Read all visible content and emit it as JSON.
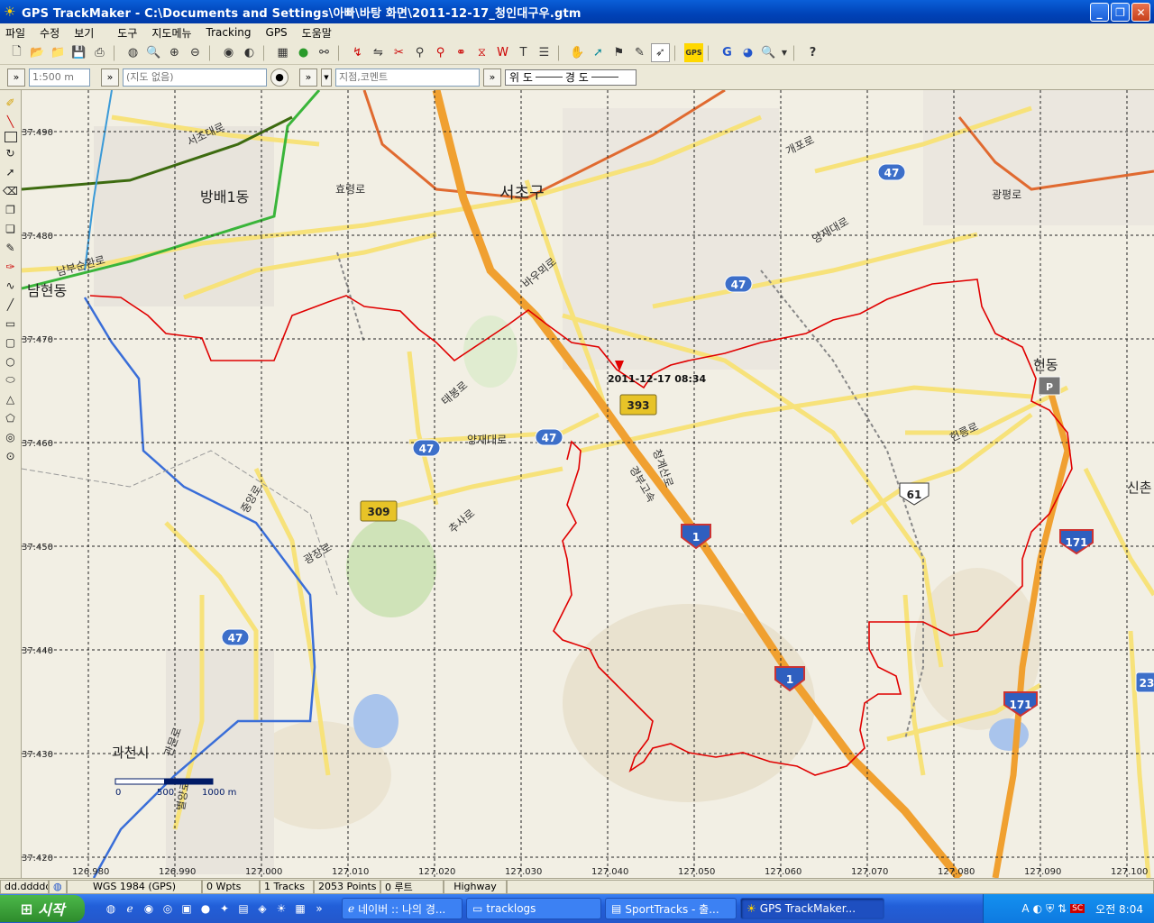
{
  "window": {
    "title": "GPS TrackMaker - C:\\Documents and Settings\\아빠\\바탕 화면\\2011-12-17_청인대구우.gtm"
  },
  "menu": [
    "파일",
    "수정",
    "보기",
    "도구",
    "지도메뉴",
    "Tracking",
    "GPS",
    "도움말"
  ],
  "toolbar2": {
    "scale_placeholder": "1:500 m",
    "map_placeholder": "(지도 없음)",
    "comment_placeholder": "지점,코멘트",
    "lat_label": "위 도",
    "lon_label": "경 도"
  },
  "map": {
    "lat_ticks": [
      "37.490",
      "37.480",
      "37.470",
      "37.460",
      "37.450",
      "37.440",
      "37.430",
      "37.420"
    ],
    "lon_ticks": [
      "126.980",
      "126.990",
      "127.000",
      "127.010",
      "127.020",
      "127.030",
      "127.040",
      "127.050",
      "127.060",
      "127.070",
      "127.080",
      "127.090",
      "127.100"
    ],
    "places": [
      "서초구",
      "방배1동",
      "남현동",
      "과천시",
      "헌동",
      "신촌"
    ],
    "roads": [
      "서초대로",
      "효령로",
      "남부순환로",
      "양재대로",
      "바우뫼로",
      "태봉로",
      "양재대로",
      "추사로",
      "광장로",
      "중앙로",
      "경부고속",
      "청계산로",
      "헌릉로",
      "개포로",
      "광평로",
      "관문로",
      "별양로"
    ],
    "shields": [
      "47",
      "47",
      "47",
      "47",
      "47",
      "393",
      "309",
      "1",
      "1",
      "61",
      "171",
      "171",
      "23"
    ],
    "track_label": "2011-12-17 08:34",
    "scale_labels": [
      "0",
      "500",
      "1000 m"
    ]
  },
  "statusbar": {
    "coord": "dd.ddddd",
    "datum": "WGS 1984 (GPS)",
    "wpts": "0 Wpts",
    "tracks": "1 Tracks",
    "points": "2053 Points",
    "routes": "0 루트",
    "layer": "Highway"
  },
  "taskbar": {
    "start": "시작",
    "tasks": [
      "네이버 :: 나의 경...",
      "tracklogs",
      "SportTracks - 출...",
      "GPS TrackMaker..."
    ],
    "clock": "오전 8:04"
  },
  "colors": {
    "track": "#e00000",
    "highway": "#f0a030",
    "road": "#f7e27a",
    "river": "#3a6ed8"
  }
}
